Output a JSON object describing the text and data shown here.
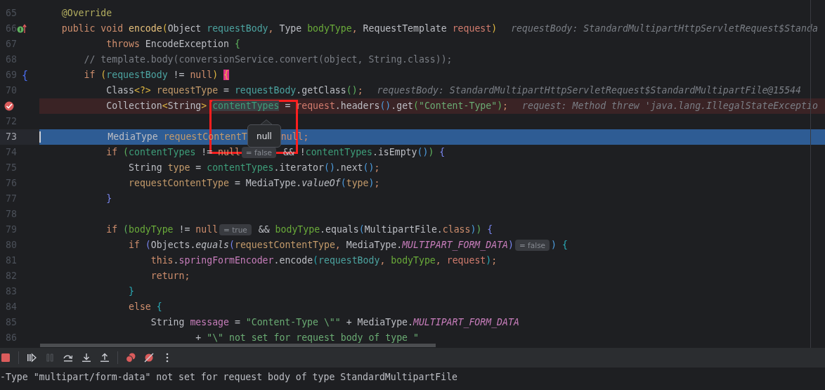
{
  "editor": {
    "lines": [
      {
        "num": "65",
        "kind": "code",
        "current": false,
        "tokens": [
          {
            "t": "    @Override",
            "kind": "ann"
          }
        ]
      },
      {
        "num": "66",
        "kind": "override",
        "current": false,
        "tokens": [
          {
            "t": "    public void ",
            "kind": "kw"
          },
          {
            "t": "encode",
            "kind": "fnd"
          },
          {
            "t": "(",
            "kind": "by"
          },
          {
            "t": "Object ",
            "kind": "pl"
          },
          {
            "t": "requestBody",
            "kind": "v1"
          },
          {
            "t": ", ",
            "kind": "kw"
          },
          {
            "t": "Type ",
            "kind": "pl"
          },
          {
            "t": "bodyType",
            "kind": "v2"
          },
          {
            "t": ", ",
            "kind": "kw"
          },
          {
            "t": "RequestTemplate ",
            "kind": "pl"
          },
          {
            "t": "request",
            "kind": "v3"
          },
          {
            "t": ")",
            "kind": "by"
          },
          {
            "t": "requestBody: StandardMultipartHttpServletRequest$Standa",
            "kind": "hint"
          }
        ]
      },
      {
        "num": "67",
        "kind": "code",
        "current": false,
        "tokens": [
          {
            "t": "            throws ",
            "kind": "kw"
          },
          {
            "t": "EncodeException ",
            "kind": "pl"
          },
          {
            "t": "{",
            "kind": "bg"
          }
        ]
      },
      {
        "num": "68",
        "kind": "code",
        "current": false,
        "tokens": [
          {
            "t": "        // template.body(conversionService.convert(object, String.class));",
            "kind": "cm"
          }
        ]
      },
      {
        "num": "69",
        "kind": "code",
        "current": false,
        "gutter_mark": "{",
        "tokens": [
          {
            "t": "        if ",
            "kind": "kw"
          },
          {
            "t": "(",
            "kind": "by"
          },
          {
            "t": "requestBody",
            "kind": "v1"
          },
          {
            "t": " != ",
            "kind": "pl"
          },
          {
            "t": "null",
            "kind": "kw"
          },
          {
            "t": ") ",
            "kind": "by"
          },
          {
            "t": "{",
            "kind": "bm"
          }
        ]
      },
      {
        "num": "70",
        "kind": "code",
        "current": false,
        "tokens": [
          {
            "t": "            Class",
            "kind": "pl"
          },
          {
            "t": "<?> ",
            "kind": "by"
          },
          {
            "t": "requestType",
            "kind": "v5"
          },
          {
            "t": " = ",
            "kind": "pl"
          },
          {
            "t": "requestBody",
            "kind": "v1"
          },
          {
            "t": ".getClass",
            "kind": "pl"
          },
          {
            "t": "()",
            "kind": "bg"
          },
          {
            "t": ";",
            "kind": "kw"
          },
          {
            "t": "requestBody: StandardMultipartHttpServletRequest$StandardMultipartFile@15544",
            "kind": "hint"
          }
        ]
      },
      {
        "kind": "breakpoint",
        "current": false,
        "tokens": [
          {
            "t": "            Collection",
            "kind": "pl"
          },
          {
            "t": "<",
            "kind": "by"
          },
          {
            "t": "String",
            "kind": "pl"
          },
          {
            "t": "> ",
            "kind": "by"
          },
          {
            "t": "contentTypes",
            "kind": "v4s"
          },
          {
            "t": " = ",
            "kind": "pl"
          },
          {
            "t": "request",
            "kind": "v3"
          },
          {
            "t": ".headers",
            "kind": "pl"
          },
          {
            "t": "()",
            "kind": "bb"
          },
          {
            "t": ".get",
            "kind": "pl"
          },
          {
            "t": "(",
            "kind": "bg"
          },
          {
            "t": "\"Content-Type\"",
            "kind": "str"
          },
          {
            "t": ")",
            "kind": "bg"
          },
          {
            "t": ";",
            "kind": "kw"
          },
          {
            "t": "request: Method threw 'java.lang.IllegalStateExceptio",
            "kind": "hint"
          }
        ]
      },
      {
        "num": "72",
        "kind": "code",
        "current": false
      },
      {
        "num": "73",
        "kind": "code",
        "current": true,
        "tokens": [
          {
            "t": "            MediaType ",
            "kind": "pl"
          },
          {
            "t": "requestContentT",
            "kind": "v5"
          },
          {
            "t": "null;",
            "kind": "gapkw"
          }
        ]
      },
      {
        "num": "74",
        "kind": "code",
        "current": false,
        "tokens": [
          {
            "t": "            if ",
            "kind": "kw"
          },
          {
            "t": "(",
            "kind": "bg"
          },
          {
            "t": "contentTypes",
            "kind": "v4"
          },
          {
            "t": " != ",
            "kind": "pl"
          },
          {
            "t": "null",
            "kind": "kw"
          },
          {
            "t": "= false",
            "kind": "inlay"
          },
          {
            "t": " && !",
            "kind": "pl"
          },
          {
            "t": "contentTypes",
            "kind": "v4"
          },
          {
            "t": ".isEmpty",
            "kind": "pl"
          },
          {
            "t": "()",
            "kind": "bb"
          },
          {
            "t": ")",
            "kind": "bg"
          },
          {
            "t": " {",
            "kind": "bp"
          }
        ]
      },
      {
        "num": "75",
        "kind": "code",
        "current": false,
        "tokens": [
          {
            "t": "                String ",
            "kind": "pl"
          },
          {
            "t": "type",
            "kind": "v5"
          },
          {
            "t": " = ",
            "kind": "pl"
          },
          {
            "t": "contentTypes",
            "kind": "v4"
          },
          {
            "t": ".iterator",
            "kind": "pl"
          },
          {
            "t": "()",
            "kind": "bb"
          },
          {
            "t": ".next",
            "kind": "pl"
          },
          {
            "t": "()",
            "kind": "bb"
          },
          {
            "t": ";",
            "kind": "kw"
          }
        ]
      },
      {
        "num": "76",
        "kind": "code",
        "current": false,
        "tokens": [
          {
            "t": "                requestContentType",
            "kind": "v5"
          },
          {
            "t": " = MediaType.",
            "kind": "pl"
          },
          {
            "t": "valueOf",
            "kind": "it"
          },
          {
            "t": "(",
            "kind": "bb"
          },
          {
            "t": "type",
            "kind": "v5"
          },
          {
            "t": ")",
            "kind": "bb"
          },
          {
            "t": ";",
            "kind": "kw"
          }
        ]
      },
      {
        "num": "77",
        "kind": "code",
        "current": false,
        "tokens": [
          {
            "t": "            }",
            "kind": "bp"
          }
        ]
      },
      {
        "num": "78",
        "kind": "code",
        "current": false
      },
      {
        "num": "79",
        "kind": "code",
        "current": false,
        "tokens": [
          {
            "t": "            if ",
            "kind": "kw"
          },
          {
            "t": "(",
            "kind": "bg"
          },
          {
            "t": "bodyType",
            "kind": "v2"
          },
          {
            "t": " != ",
            "kind": "pl"
          },
          {
            "t": "null",
            "kind": "kw"
          },
          {
            "t": "= true",
            "kind": "inlay"
          },
          {
            "t": " && ",
            "kind": "pl"
          },
          {
            "t": "bodyType",
            "kind": "v2"
          },
          {
            "t": ".equals",
            "kind": "pl"
          },
          {
            "t": "(",
            "kind": "bb"
          },
          {
            "t": "MultipartFile.",
            "kind": "pl"
          },
          {
            "t": "class",
            "kind": "kw"
          },
          {
            "t": ")",
            "kind": "bb"
          },
          {
            "t": ")",
            "kind": "bg"
          },
          {
            "t": " {",
            "kind": "bp"
          }
        ]
      },
      {
        "num": "80",
        "kind": "code",
        "current": false,
        "tokens": [
          {
            "t": "                if ",
            "kind": "kw"
          },
          {
            "t": "(",
            "kind": "bp"
          },
          {
            "t": "Objects.",
            "kind": "pl"
          },
          {
            "t": "equals",
            "kind": "it"
          },
          {
            "t": "(",
            "kind": "bp"
          },
          {
            "t": "requestContentType",
            "kind": "v5"
          },
          {
            "t": ", ",
            "kind": "kw"
          },
          {
            "t": "MediaType.",
            "kind": "pl"
          },
          {
            "t": "MULTIPART_FORM_DATA",
            "kind": "st"
          },
          {
            "t": ")",
            "kind": "bp"
          },
          {
            "t": "= false",
            "kind": "inlay"
          },
          {
            "t": ")",
            "kind": "bb"
          },
          {
            "t": " {",
            "kind": "bt"
          }
        ]
      },
      {
        "num": "81",
        "kind": "code",
        "current": false,
        "tokens": [
          {
            "t": "                    this",
            "kind": "kw"
          },
          {
            "t": ".",
            "kind": "pl"
          },
          {
            "t": "springFormEncoder",
            "kind": "fld"
          },
          {
            "t": ".encode",
            "kind": "pl"
          },
          {
            "t": "(",
            "kind": "bt"
          },
          {
            "t": "requestBody",
            "kind": "v1"
          },
          {
            "t": ", ",
            "kind": "kw"
          },
          {
            "t": "bodyType",
            "kind": "v2"
          },
          {
            "t": ", ",
            "kind": "kw"
          },
          {
            "t": "request",
            "kind": "v3"
          },
          {
            "t": ")",
            "kind": "bt"
          },
          {
            "t": ";",
            "kind": "kw"
          }
        ]
      },
      {
        "num": "82",
        "kind": "code",
        "current": false,
        "tokens": [
          {
            "t": "                    return;",
            "kind": "kw"
          }
        ]
      },
      {
        "num": "83",
        "kind": "code",
        "current": false,
        "tokens": [
          {
            "t": "                }",
            "kind": "bt"
          }
        ]
      },
      {
        "num": "84",
        "kind": "code",
        "current": false,
        "tokens": [
          {
            "t": "                else ",
            "kind": "kw"
          },
          {
            "t": "{",
            "kind": "bt"
          }
        ]
      },
      {
        "num": "85",
        "kind": "code",
        "current": false,
        "tokens": [
          {
            "t": "                    String ",
            "kind": "pl"
          },
          {
            "t": "message",
            "kind": "fld"
          },
          {
            "t": " = ",
            "kind": "pl"
          },
          {
            "t": "\"Content-Type \\\"\"",
            "kind": "str"
          },
          {
            "t": " + MediaType.",
            "kind": "pl"
          },
          {
            "t": "MULTIPART_FORM_DATA",
            "kind": "st"
          }
        ]
      },
      {
        "num": "86",
        "kind": "code",
        "current": false,
        "tokens": [
          {
            "t": "                            + ",
            "kind": "pl"
          },
          {
            "t": "\"\\\" not set for request body of type \"",
            "kind": "str"
          }
        ]
      }
    ],
    "tooltip": {
      "text": "null"
    }
  },
  "toolbar": [
    {
      "kind": "stop",
      "disabled": false
    },
    {
      "kind": "separator"
    },
    {
      "kind": "resume",
      "disabled": false
    },
    {
      "kind": "pause",
      "disabled": true
    },
    {
      "kind": "step-over",
      "disabled": false
    },
    {
      "kind": "step-into",
      "disabled": false
    },
    {
      "kind": "step-out",
      "disabled": false
    },
    {
      "kind": "separator"
    },
    {
      "kind": "breakpoints",
      "disabled": false
    },
    {
      "kind": "mute",
      "disabled": false
    },
    {
      "kind": "more",
      "disabled": false
    }
  ],
  "console": {
    "lines": [
      "-Type \"multipart/form-data\" not set for request body of type StandardMultipartFile"
    ]
  }
}
